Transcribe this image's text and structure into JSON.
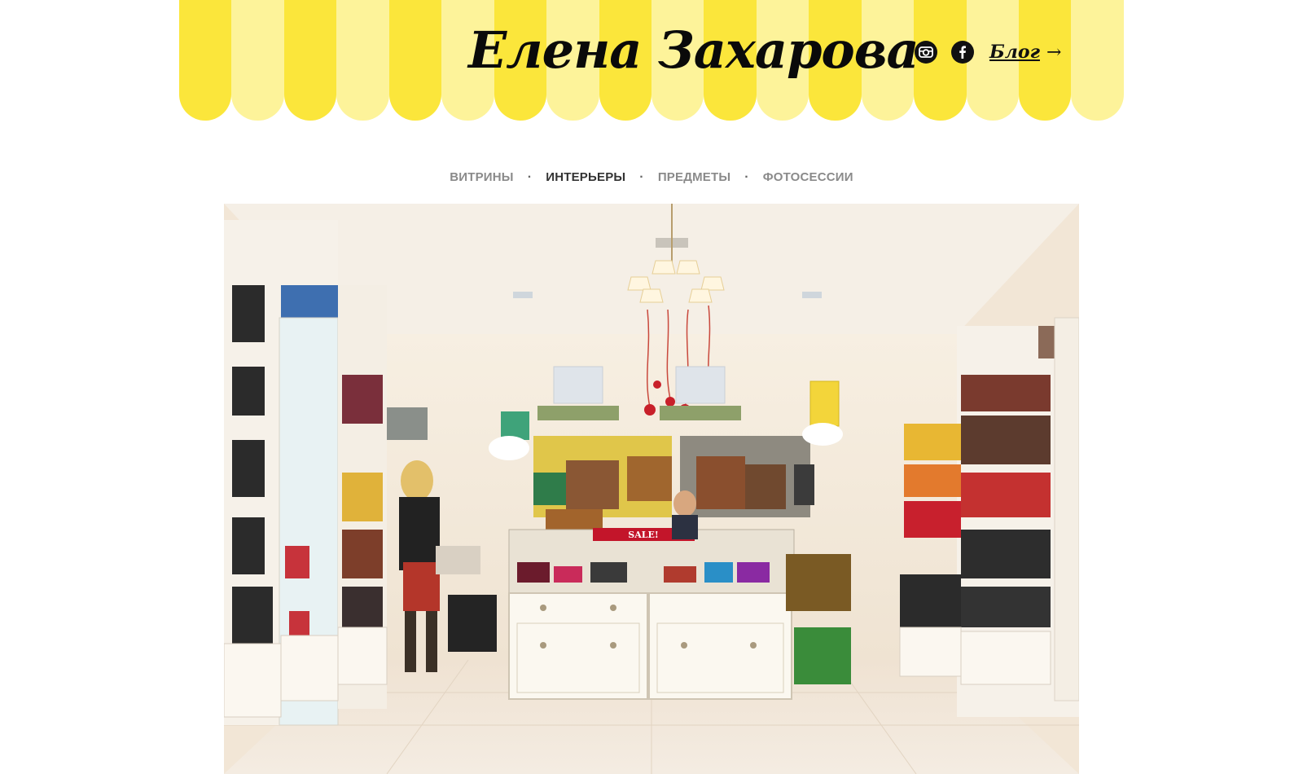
{
  "header": {
    "title": "Елена Захарова",
    "stripe_colors": [
      "#fbe63b",
      "#fdf39a"
    ],
    "social": [
      {
        "icon": "camera-icon"
      },
      {
        "icon": "facebook-icon"
      }
    ],
    "blog_link": {
      "label": "Блог",
      "arrow": "→"
    }
  },
  "nav": {
    "items": [
      {
        "label": "ВИТРИНЫ",
        "active": false
      },
      {
        "label": "ИНТЕРЬЕРЫ",
        "active": true
      },
      {
        "label": "ПРЕДМЕТЫ",
        "active": false
      },
      {
        "label": "ФОТОСЕССИИ",
        "active": false
      }
    ],
    "separator": "·"
  },
  "photo": {
    "sign_text": "SALE!"
  },
  "colors": {
    "accent_yellow": "#fbe63b",
    "pale_yellow": "#fdf39a",
    "nav_active": "#333333",
    "nav_inactive": "#8a8a8a"
  }
}
